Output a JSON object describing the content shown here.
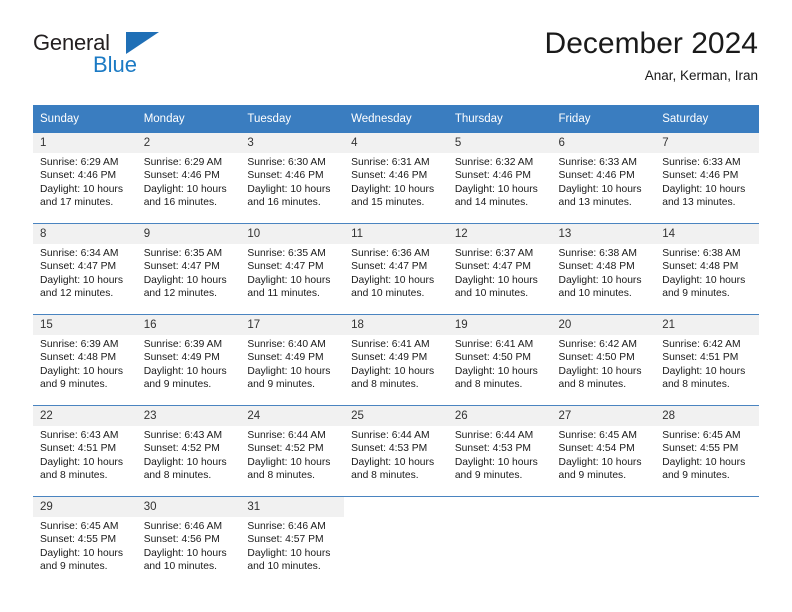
{
  "logo": {
    "name_part1": "General",
    "name_part2": "Blue",
    "icon": "triangle-icon",
    "accent_color": "#1b7ac4"
  },
  "header": {
    "title": "December 2024",
    "location": "Anar, Kerman, Iran"
  },
  "theme": {
    "header_row_bg": "#3a7dc0",
    "daynum_bg": "#f1f1f1",
    "row_divider": "#4a84c0",
    "text": "#1a1a1a"
  },
  "weekday_headers": [
    "Sunday",
    "Monday",
    "Tuesday",
    "Wednesday",
    "Thursday",
    "Friday",
    "Saturday"
  ],
  "weeks": [
    [
      {
        "day": "1",
        "sunrise": "Sunrise: 6:29 AM",
        "sunset": "Sunset: 4:46 PM",
        "daylight_line1": "Daylight: 10 hours",
        "daylight_line2": "and 17 minutes."
      },
      {
        "day": "2",
        "sunrise": "Sunrise: 6:29 AM",
        "sunset": "Sunset: 4:46 PM",
        "daylight_line1": "Daylight: 10 hours",
        "daylight_line2": "and 16 minutes."
      },
      {
        "day": "3",
        "sunrise": "Sunrise: 6:30 AM",
        "sunset": "Sunset: 4:46 PM",
        "daylight_line1": "Daylight: 10 hours",
        "daylight_line2": "and 16 minutes."
      },
      {
        "day": "4",
        "sunrise": "Sunrise: 6:31 AM",
        "sunset": "Sunset: 4:46 PM",
        "daylight_line1": "Daylight: 10 hours",
        "daylight_line2": "and 15 minutes."
      },
      {
        "day": "5",
        "sunrise": "Sunrise: 6:32 AM",
        "sunset": "Sunset: 4:46 PM",
        "daylight_line1": "Daylight: 10 hours",
        "daylight_line2": "and 14 minutes."
      },
      {
        "day": "6",
        "sunrise": "Sunrise: 6:33 AM",
        "sunset": "Sunset: 4:46 PM",
        "daylight_line1": "Daylight: 10 hours",
        "daylight_line2": "and 13 minutes."
      },
      {
        "day": "7",
        "sunrise": "Sunrise: 6:33 AM",
        "sunset": "Sunset: 4:46 PM",
        "daylight_line1": "Daylight: 10 hours",
        "daylight_line2": "and 13 minutes."
      }
    ],
    [
      {
        "day": "8",
        "sunrise": "Sunrise: 6:34 AM",
        "sunset": "Sunset: 4:47 PM",
        "daylight_line1": "Daylight: 10 hours",
        "daylight_line2": "and 12 minutes."
      },
      {
        "day": "9",
        "sunrise": "Sunrise: 6:35 AM",
        "sunset": "Sunset: 4:47 PM",
        "daylight_line1": "Daylight: 10 hours",
        "daylight_line2": "and 12 minutes."
      },
      {
        "day": "10",
        "sunrise": "Sunrise: 6:35 AM",
        "sunset": "Sunset: 4:47 PM",
        "daylight_line1": "Daylight: 10 hours",
        "daylight_line2": "and 11 minutes."
      },
      {
        "day": "11",
        "sunrise": "Sunrise: 6:36 AM",
        "sunset": "Sunset: 4:47 PM",
        "daylight_line1": "Daylight: 10 hours",
        "daylight_line2": "and 10 minutes."
      },
      {
        "day": "12",
        "sunrise": "Sunrise: 6:37 AM",
        "sunset": "Sunset: 4:47 PM",
        "daylight_line1": "Daylight: 10 hours",
        "daylight_line2": "and 10 minutes."
      },
      {
        "day": "13",
        "sunrise": "Sunrise: 6:38 AM",
        "sunset": "Sunset: 4:48 PM",
        "daylight_line1": "Daylight: 10 hours",
        "daylight_line2": "and 10 minutes."
      },
      {
        "day": "14",
        "sunrise": "Sunrise: 6:38 AM",
        "sunset": "Sunset: 4:48 PM",
        "daylight_line1": "Daylight: 10 hours",
        "daylight_line2": "and 9 minutes."
      }
    ],
    [
      {
        "day": "15",
        "sunrise": "Sunrise: 6:39 AM",
        "sunset": "Sunset: 4:48 PM",
        "daylight_line1": "Daylight: 10 hours",
        "daylight_line2": "and 9 minutes."
      },
      {
        "day": "16",
        "sunrise": "Sunrise: 6:39 AM",
        "sunset": "Sunset: 4:49 PM",
        "daylight_line1": "Daylight: 10 hours",
        "daylight_line2": "and 9 minutes."
      },
      {
        "day": "17",
        "sunrise": "Sunrise: 6:40 AM",
        "sunset": "Sunset: 4:49 PM",
        "daylight_line1": "Daylight: 10 hours",
        "daylight_line2": "and 9 minutes."
      },
      {
        "day": "18",
        "sunrise": "Sunrise: 6:41 AM",
        "sunset": "Sunset: 4:49 PM",
        "daylight_line1": "Daylight: 10 hours",
        "daylight_line2": "and 8 minutes."
      },
      {
        "day": "19",
        "sunrise": "Sunrise: 6:41 AM",
        "sunset": "Sunset: 4:50 PM",
        "daylight_line1": "Daylight: 10 hours",
        "daylight_line2": "and 8 minutes."
      },
      {
        "day": "20",
        "sunrise": "Sunrise: 6:42 AM",
        "sunset": "Sunset: 4:50 PM",
        "daylight_line1": "Daylight: 10 hours",
        "daylight_line2": "and 8 minutes."
      },
      {
        "day": "21",
        "sunrise": "Sunrise: 6:42 AM",
        "sunset": "Sunset: 4:51 PM",
        "daylight_line1": "Daylight: 10 hours",
        "daylight_line2": "and 8 minutes."
      }
    ],
    [
      {
        "day": "22",
        "sunrise": "Sunrise: 6:43 AM",
        "sunset": "Sunset: 4:51 PM",
        "daylight_line1": "Daylight: 10 hours",
        "daylight_line2": "and 8 minutes."
      },
      {
        "day": "23",
        "sunrise": "Sunrise: 6:43 AM",
        "sunset": "Sunset: 4:52 PM",
        "daylight_line1": "Daylight: 10 hours",
        "daylight_line2": "and 8 minutes."
      },
      {
        "day": "24",
        "sunrise": "Sunrise: 6:44 AM",
        "sunset": "Sunset: 4:52 PM",
        "daylight_line1": "Daylight: 10 hours",
        "daylight_line2": "and 8 minutes."
      },
      {
        "day": "25",
        "sunrise": "Sunrise: 6:44 AM",
        "sunset": "Sunset: 4:53 PM",
        "daylight_line1": "Daylight: 10 hours",
        "daylight_line2": "and 8 minutes."
      },
      {
        "day": "26",
        "sunrise": "Sunrise: 6:44 AM",
        "sunset": "Sunset: 4:53 PM",
        "daylight_line1": "Daylight: 10 hours",
        "daylight_line2": "and 9 minutes."
      },
      {
        "day": "27",
        "sunrise": "Sunrise: 6:45 AM",
        "sunset": "Sunset: 4:54 PM",
        "daylight_line1": "Daylight: 10 hours",
        "daylight_line2": "and 9 minutes."
      },
      {
        "day": "28",
        "sunrise": "Sunrise: 6:45 AM",
        "sunset": "Sunset: 4:55 PM",
        "daylight_line1": "Daylight: 10 hours",
        "daylight_line2": "and 9 minutes."
      }
    ],
    [
      {
        "day": "29",
        "sunrise": "Sunrise: 6:45 AM",
        "sunset": "Sunset: 4:55 PM",
        "daylight_line1": "Daylight: 10 hours",
        "daylight_line2": "and 9 minutes."
      },
      {
        "day": "30",
        "sunrise": "Sunrise: 6:46 AM",
        "sunset": "Sunset: 4:56 PM",
        "daylight_line1": "Daylight: 10 hours",
        "daylight_line2": "and 10 minutes."
      },
      {
        "day": "31",
        "sunrise": "Sunrise: 6:46 AM",
        "sunset": "Sunset: 4:57 PM",
        "daylight_line1": "Daylight: 10 hours",
        "daylight_line2": "and 10 minutes."
      },
      {
        "day": "",
        "sunrise": "",
        "sunset": "",
        "daylight_line1": "",
        "daylight_line2": ""
      },
      {
        "day": "",
        "sunrise": "",
        "sunset": "",
        "daylight_line1": "",
        "daylight_line2": ""
      },
      {
        "day": "",
        "sunrise": "",
        "sunset": "",
        "daylight_line1": "",
        "daylight_line2": ""
      },
      {
        "day": "",
        "sunrise": "",
        "sunset": "",
        "daylight_line1": "",
        "daylight_line2": ""
      }
    ]
  ]
}
